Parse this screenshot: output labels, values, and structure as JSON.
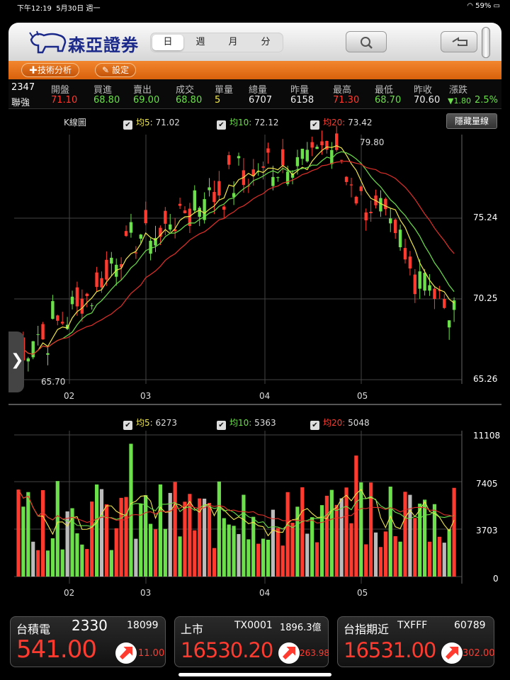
{
  "status_bar": {
    "time": "下午12:19",
    "date": "5月30日 週一",
    "battery": "59%"
  },
  "header": {
    "brand": "森亞證券",
    "periods": [
      "日",
      "週",
      "月",
      "分"
    ],
    "active_period": "日",
    "icons": [
      "search-icon",
      "back-icon"
    ]
  },
  "toolbar": {
    "analysis_label": "技術分析",
    "settings_label": "設定"
  },
  "quote": {
    "code": "2347",
    "name": "聯強",
    "open_label": "開盤",
    "open": "71.10",
    "bid_label": "買進",
    "bid": "68.80",
    "ask_label": "賣出",
    "ask": "69.00",
    "deal_label": "成交",
    "deal": "68.80",
    "lot_label": "單量",
    "lot": "5",
    "volume_label": "總量",
    "volume": "6707",
    "yvol_label": "昨量",
    "yvol": "6158",
    "high_label": "最高",
    "high": "71.30",
    "low_label": "最低",
    "low": "68.70",
    "prev_label": "昨收",
    "prev": "70.60",
    "change_label": "漲跌",
    "change": "▼1.80",
    "change_pct": "2.5%"
  },
  "kline": {
    "title": "K線圖",
    "hide_volume": "隱藏量線",
    "ma5_label": "均5:",
    "ma5": "71.02",
    "ma10_label": "均10:",
    "ma10": "72.12",
    "ma20_label": "均20:",
    "ma20": "73.42",
    "y_labels": [
      "75.24",
      "70.25",
      "65.26"
    ],
    "x_labels": [
      "02",
      "03",
      "04",
      "05"
    ],
    "max_label": "79.80",
    "min_label": "65.70"
  },
  "volume": {
    "ma5_label": "均5:",
    "ma5": "6273",
    "ma10_label": "均10:",
    "ma10": "5363",
    "ma20_label": "均20:",
    "ma20": "5048",
    "y_labels": [
      "11108",
      "7405",
      "3703",
      "0"
    ],
    "x_labels": [
      "02",
      "03",
      "04",
      "05"
    ]
  },
  "colors": {
    "up": "#ff3b30",
    "down": "#6be04a",
    "ma5": "#f1e84a",
    "ma10": "#6be04a",
    "ma20": "#e0302a",
    "orange": "#e8731c"
  },
  "bottom": {
    "cards": [
      {
        "name": "台積電",
        "code": "2330",
        "vol": "18099",
        "price": "541.00",
        "change": "11.00"
      },
      {
        "name": "上市",
        "code": "TX0001",
        "vol": "1896.3億",
        "price": "16530.20",
        "change": "263.98"
      },
      {
        "name": "台指期近",
        "code": "TXFFF",
        "vol": "60789",
        "price": "16531.00",
        "change": "302.00"
      }
    ]
  }
}
